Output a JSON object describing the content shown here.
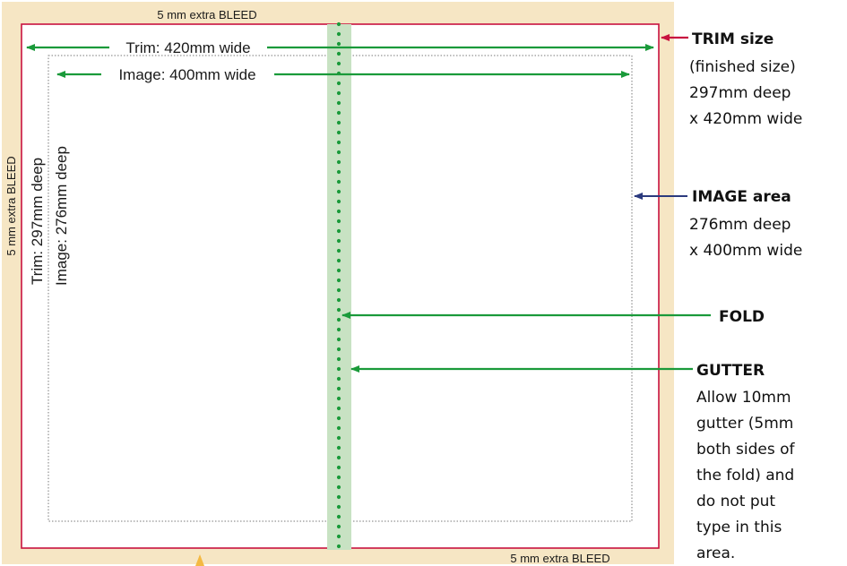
{
  "colors": {
    "bleed_fill": "#f6e6c4",
    "trim_line": "#c8123f",
    "image_border": "#7a7a7a",
    "gutter_fill": "#c8e2c3",
    "arrow_green": "#1a9a3a",
    "arrow_navy": "#2b3a7e",
    "fold_dot": "#1a9a3a",
    "marker_orange": "#f4b942"
  },
  "bleed": {
    "top": "5 mm extra BLEED",
    "bottom": "5 mm extra BLEED",
    "left": "5 mm extra BLEED"
  },
  "dimensions": {
    "trim_width": "Trim: 420mm wide",
    "image_width": "Image: 400mm wide",
    "trim_depth": "Trim: 297mm deep",
    "image_depth": "Image: 276mm deep"
  },
  "legend": {
    "trim": {
      "heading": "TRIM size",
      "lines": [
        "(finished size)",
        "297mm deep",
        "x 420mm wide"
      ]
    },
    "image": {
      "heading": "IMAGE area",
      "lines": [
        "276mm deep",
        "x 400mm wide"
      ]
    },
    "fold": {
      "heading": "FOLD"
    },
    "gutter": {
      "heading": "GUTTER",
      "lines": [
        "Allow 10mm",
        "gutter (5mm",
        "both sides of",
        "the fold) and",
        "do not put",
        "type in this",
        "area."
      ]
    }
  }
}
